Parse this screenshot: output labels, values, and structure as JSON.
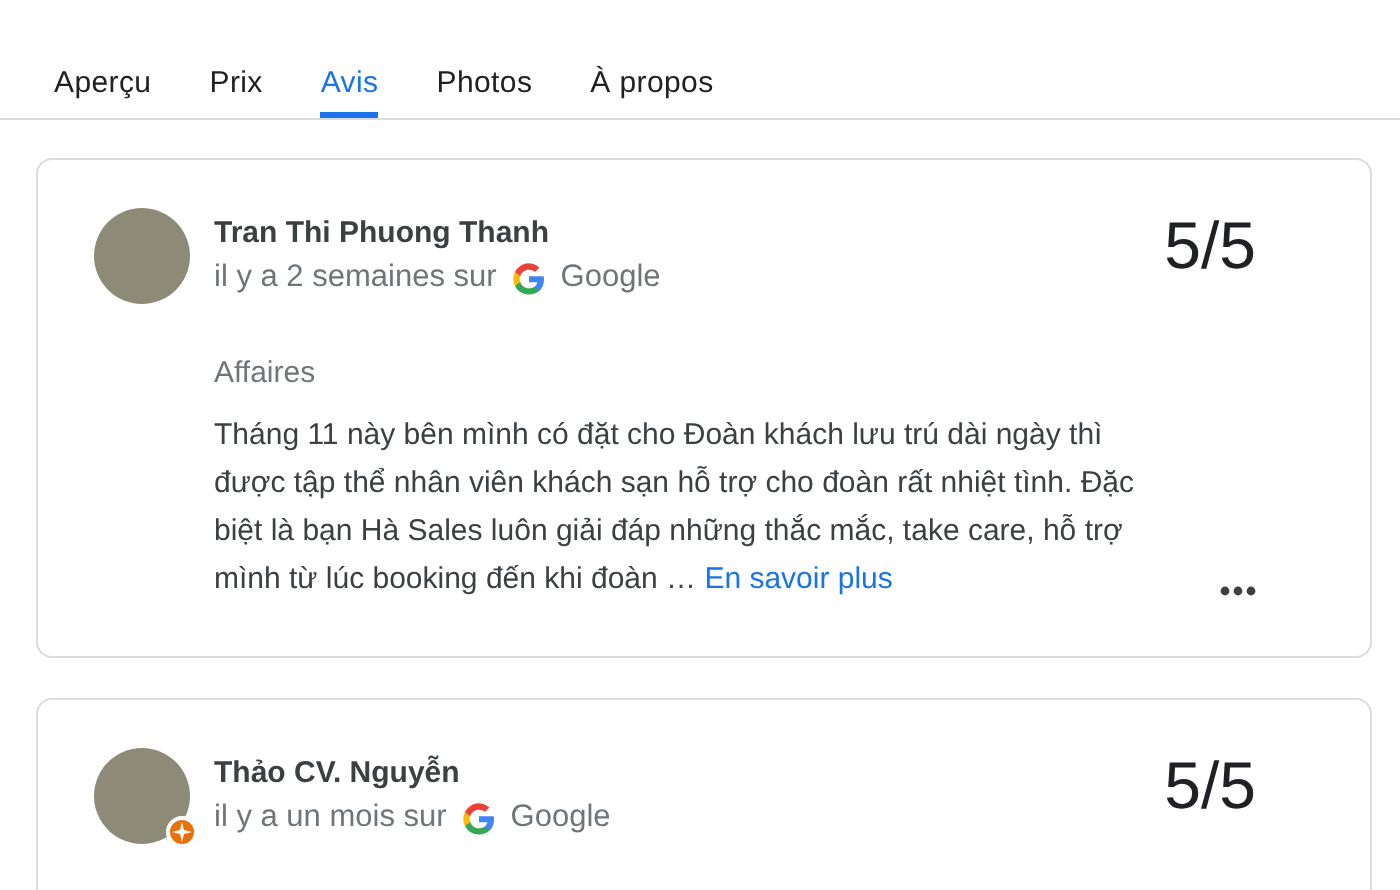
{
  "tabs": [
    {
      "label": "Aperçu",
      "selected": false
    },
    {
      "label": "Prix",
      "selected": false
    },
    {
      "label": "Avis",
      "selected": true
    },
    {
      "label": "Photos",
      "selected": false
    },
    {
      "label": "À propos",
      "selected": false
    }
  ],
  "reviews": [
    {
      "name": "Tran Thi Phuong Thanh",
      "local_guide": false,
      "time": "il y a 2 semaines sur",
      "source": "Google",
      "rating": "5/5",
      "category": "Affaires",
      "text": "Tháng 11 này bên mình có đặt cho Đoàn khách lưu trú dài ngày thì được tập thể nhân viên khách sạn hỗ trợ cho đoàn rất nhiệt tình. Đặc biệt là bạn Hà Sales luôn giải đáp những thắc mắc, take care, hỗ trợ mình từ lúc booking đến khi đoàn …",
      "more_link": "En savoir plus"
    },
    {
      "name": "Thảo CV. Nguyễn",
      "local_guide": true,
      "time": "il y a un mois sur",
      "source": "Google",
      "rating": "5/5"
    }
  ]
}
